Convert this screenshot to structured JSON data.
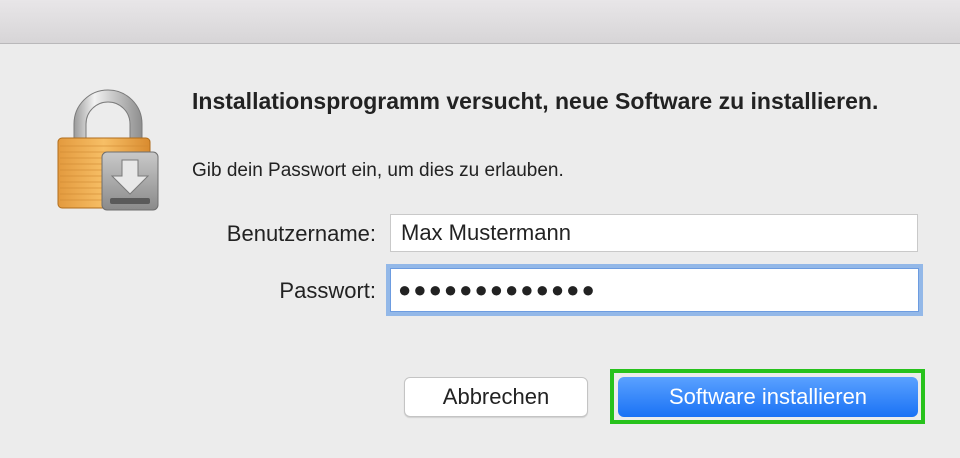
{
  "dialog": {
    "title": "Installationsprogramm versucht, neue Software zu installieren.",
    "message": "Gib dein Passwort ein, um dies zu erlauben.",
    "username_label": "Benutzername:",
    "username_value": "Max Mustermann",
    "password_label": "Passwort:",
    "password_value": "●●●●●●●●●●●●●",
    "cancel_label": "Abbrechen",
    "install_label": "Software installieren"
  },
  "icons": {
    "lock": "lock-with-installer-icon"
  },
  "colors": {
    "accent": "#1a72f5",
    "highlight": "#27c21c",
    "focus_ring": "#93b8e8"
  }
}
